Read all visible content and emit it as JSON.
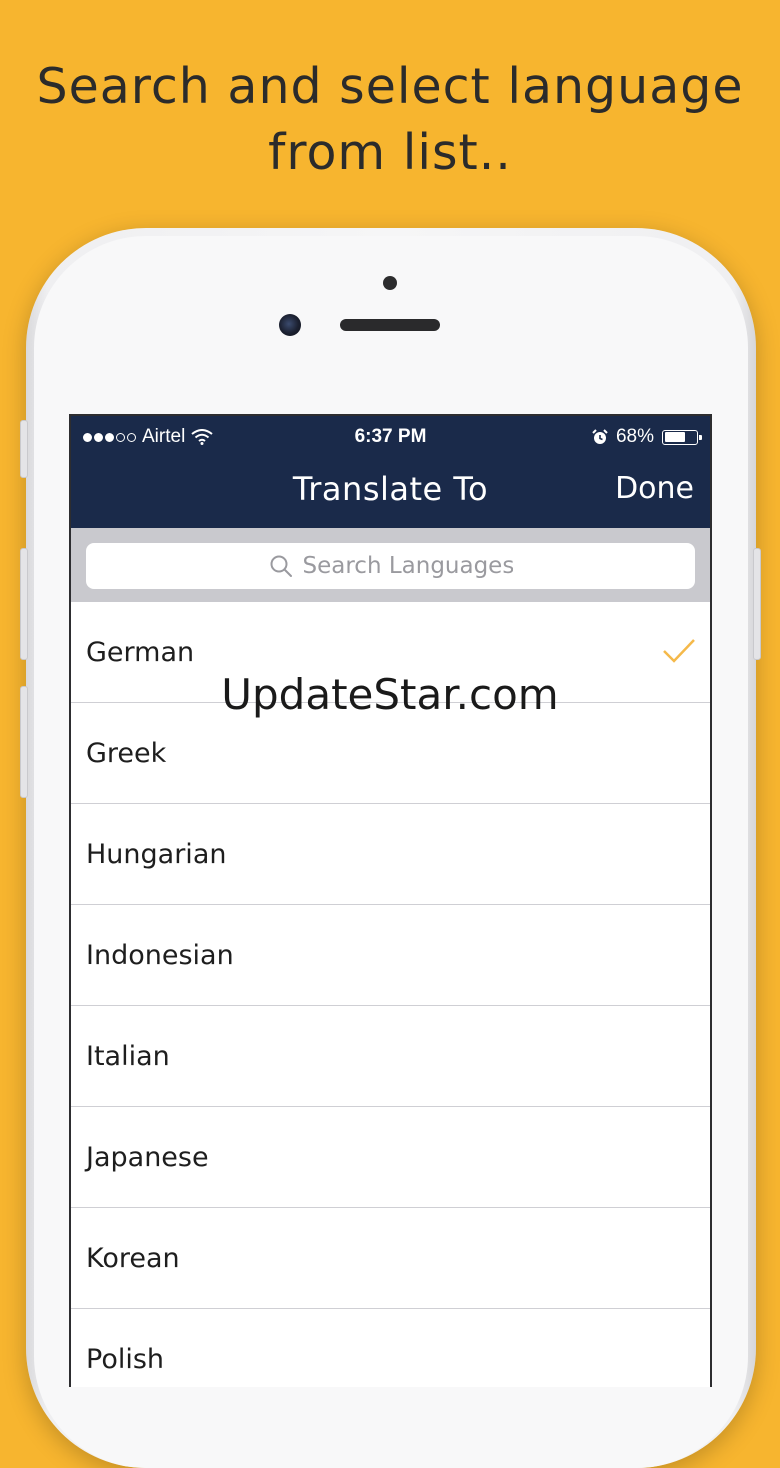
{
  "promo": {
    "headline_line1": "Search and select language",
    "headline_line2": "from list.."
  },
  "status_bar": {
    "carrier": "Airtel",
    "time": "6:37 PM",
    "battery": "68%",
    "battery_level": 0.68
  },
  "navbar": {
    "title": "Translate To",
    "done_label": "Done"
  },
  "search": {
    "placeholder": "Search Languages",
    "value": ""
  },
  "languages": [
    {
      "label": "German",
      "selected": true
    },
    {
      "label": "Greek",
      "selected": false
    },
    {
      "label": "Hungarian",
      "selected": false
    },
    {
      "label": "Indonesian",
      "selected": false
    },
    {
      "label": "Italian",
      "selected": false
    },
    {
      "label": "Japanese",
      "selected": false
    },
    {
      "label": "Korean",
      "selected": false
    },
    {
      "label": "Polish",
      "selected": false
    }
  ],
  "watermark": "UpdateStar.com",
  "colors": {
    "background": "#F7B52F",
    "navbar": "#1A2A4A",
    "checkmark": "#F5B94A"
  }
}
